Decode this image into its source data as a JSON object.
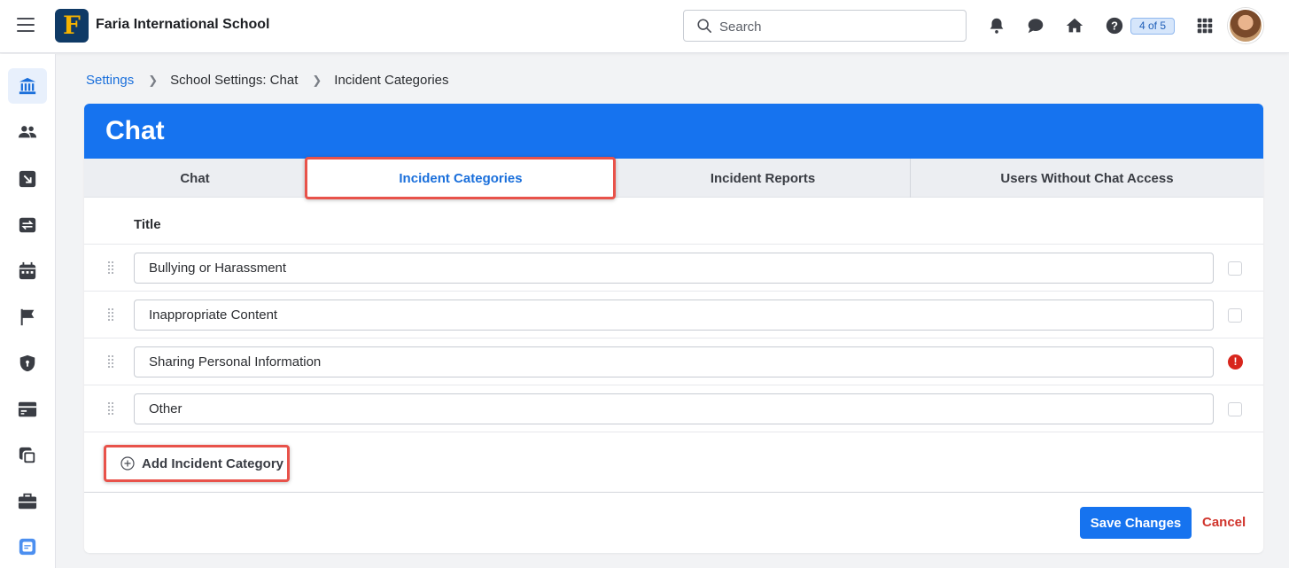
{
  "app": {
    "school_name": "Faria International School",
    "logo_letter": "F"
  },
  "topbar": {
    "search_placeholder": "Search",
    "icons": [
      "bell-icon",
      "chat-bubble-icon",
      "home-icon",
      "help-icon"
    ],
    "progress_pill": "4 of 5",
    "apps_icon": "apps-grid-icon"
  },
  "sidebar": {
    "items": [
      {
        "icon": "institution-icon",
        "active": true
      },
      {
        "icon": "people-icon",
        "active": false
      },
      {
        "icon": "arrow-down-right-icon",
        "active": false
      },
      {
        "icon": "exchange-icon",
        "active": false
      },
      {
        "icon": "calendar-icon",
        "active": false
      },
      {
        "icon": "flag-icon",
        "active": false
      },
      {
        "icon": "shield-icon",
        "active": false
      },
      {
        "icon": "cards-icon",
        "active": false
      },
      {
        "icon": "copy-icon",
        "active": false
      },
      {
        "icon": "briefcase-icon",
        "active": false
      },
      {
        "icon": "app-badge-icon",
        "active": false
      }
    ]
  },
  "breadcrumb": {
    "items": [
      "Settings",
      "School Settings: Chat",
      "Incident Categories"
    ]
  },
  "card": {
    "title": "Chat",
    "tabs": [
      {
        "label": "Chat",
        "active": false
      },
      {
        "label": "Incident Categories",
        "active": true
      },
      {
        "label": "Incident Reports",
        "active": false
      },
      {
        "label": "Users Without Chat Access",
        "active": false
      }
    ],
    "column_header": "Title",
    "categories": [
      {
        "title": "Bullying or Harassment",
        "status": "checkbox"
      },
      {
        "title": "Inappropriate Content",
        "status": "checkbox"
      },
      {
        "title": "Sharing Personal Information",
        "status": "error"
      },
      {
        "title": "Other",
        "status": "checkbox"
      }
    ],
    "error_mark": "!",
    "add_label": "Add Incident Category",
    "save_label": "Save Changes",
    "cancel_label": "Cancel"
  },
  "colors": {
    "primary": "#1673ef",
    "link": "#1a6fdb",
    "highlight": "#e8524a",
    "danger": "#d0342c"
  }
}
